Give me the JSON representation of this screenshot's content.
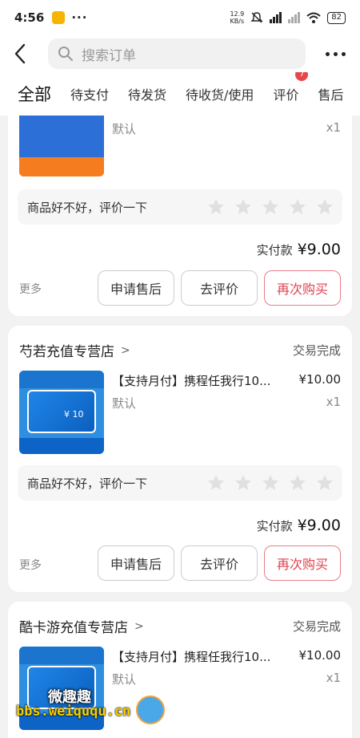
{
  "status_bar": {
    "time": "4:56",
    "more": "···",
    "net_speed_value": "12.9",
    "net_speed_unit": "KB/s",
    "battery": "82"
  },
  "header": {
    "search_placeholder": "搜索订单"
  },
  "tabs": [
    {
      "label": "全部",
      "active": true
    },
    {
      "label": "待支付"
    },
    {
      "label": "待发货"
    },
    {
      "label": "待收货/使用"
    },
    {
      "label": "评价",
      "badge": "7"
    },
    {
      "label": "售后"
    }
  ],
  "orders": [
    {
      "product": {
        "spec": "默认",
        "qty": "x1"
      },
      "review_prompt": "商品好不好，评价一下",
      "paid_label": "实付款",
      "paid_amount": "¥9.00",
      "more": "更多",
      "buttons": [
        "申请售后",
        "去评价",
        "再次购买"
      ]
    },
    {
      "shop": "芍若充值专营店",
      "status": "交易完成",
      "product": {
        "title": "【支持月付】携程任我行10...",
        "price": "¥10.00",
        "spec": "默认",
        "qty": "x1"
      },
      "review_prompt": "商品好不好，评价一下",
      "paid_label": "实付款",
      "paid_amount": "¥9.00",
      "more": "更多",
      "buttons": [
        "申请售后",
        "去评价",
        "再次购买"
      ]
    },
    {
      "shop": "酷卡游充值专营店",
      "status": "交易完成",
      "product": {
        "title": "【支持月付】携程任我行10...",
        "price": "¥10.00",
        "spec": "默认",
        "qty": "x1"
      }
    }
  ],
  "watermark": {
    "name": "微趣趣",
    "url": "bbs.weiququ.cn"
  },
  "colors": {
    "accent_red": "#e0404f",
    "badge_red": "#e8474a"
  }
}
